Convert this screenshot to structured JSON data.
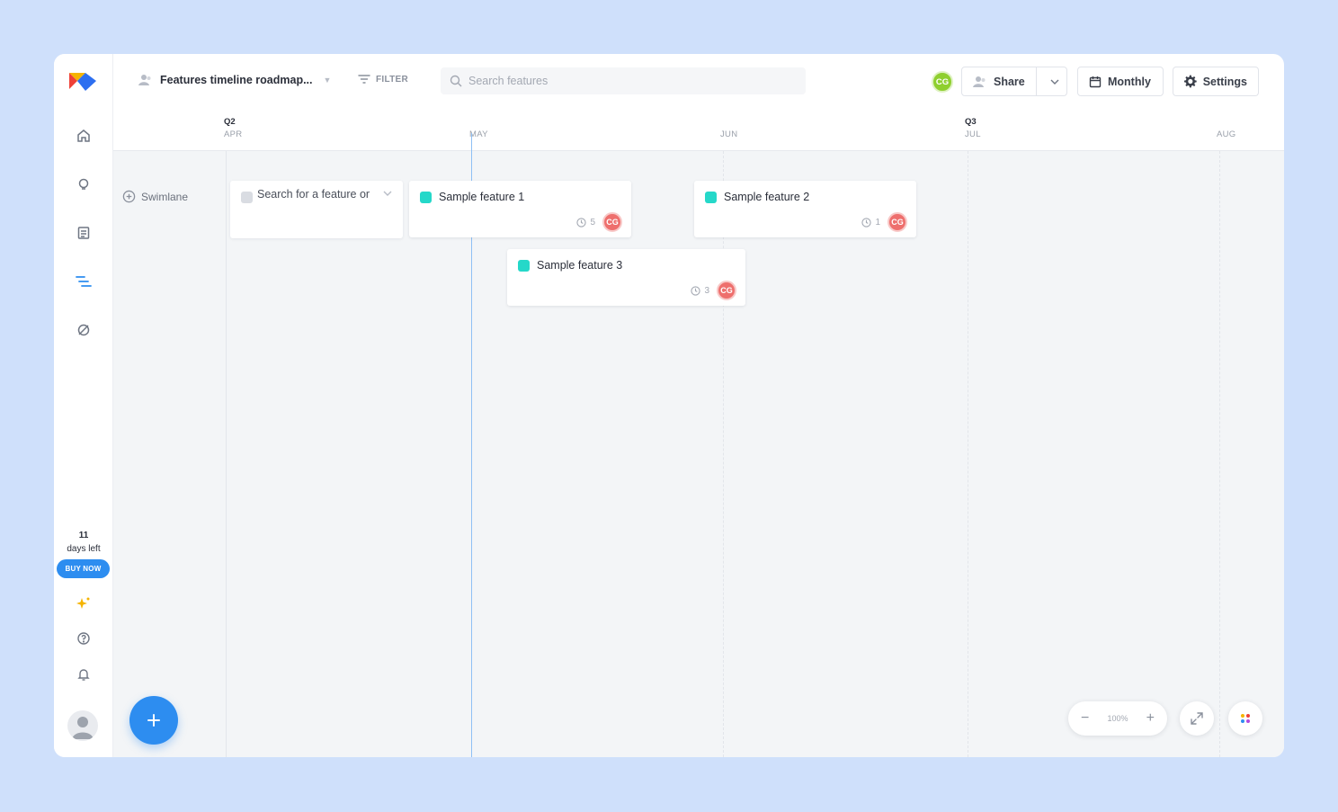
{
  "topbar": {
    "roadmap_title": "Features timeline roadmap...",
    "filter_label": "FILTER",
    "search_placeholder": "Search features",
    "user_initials": "CG",
    "share_label": "Share",
    "monthly_label": "Monthly",
    "settings_label": "Settings"
  },
  "sidebar": {
    "items": [
      {
        "icon": "home-icon"
      },
      {
        "icon": "lightbulb-icon"
      },
      {
        "icon": "document-icon"
      },
      {
        "icon": "roadmap-icon",
        "active": true
      },
      {
        "icon": "hidden-icon"
      }
    ],
    "trial_days": "11",
    "trial_text": "days left",
    "buy_now_label": "BUY NOW"
  },
  "timeline": {
    "quarters": [
      {
        "label": "Q2"
      },
      {
        "label": "Q3"
      }
    ],
    "months": [
      {
        "label": "APR"
      },
      {
        "label": "MAY"
      },
      {
        "label": "JUN"
      },
      {
        "label": "JUL"
      },
      {
        "label": "AUG"
      }
    ]
  },
  "swimlane": {
    "label": "Swimlane",
    "new_feature_placeholder": "Search for a feature or"
  },
  "features": [
    {
      "name": "Sample feature 1",
      "count": "5",
      "owner": "CG"
    },
    {
      "name": "Sample feature 2",
      "count": "1",
      "owner": "CG"
    },
    {
      "name": "Sample feature 3",
      "count": "3",
      "owner": "CG"
    }
  ],
  "controls": {
    "zoom_level": "100%"
  },
  "colors": {
    "accent": "#2d8df0",
    "feature_swatch": "#25d8c9",
    "owner_avatar": "#ee6f6d",
    "user_avatar": "#8fcf2f"
  }
}
